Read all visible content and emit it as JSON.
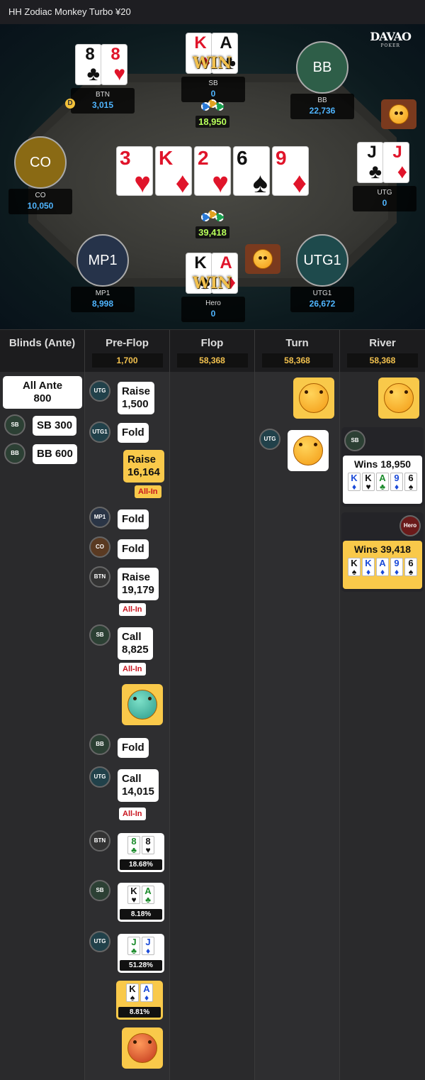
{
  "title": "HH  Zodiac Monkey Turbo ¥20",
  "logo": {
    "name": "DAVAO",
    "sub": "POKER"
  },
  "seats": [
    {
      "id": "btn",
      "name": "BTN",
      "stack": "3,015"
    },
    {
      "id": "sb",
      "name": "SB",
      "stack": "0",
      "win": "WIN"
    },
    {
      "id": "bb",
      "name": "BB",
      "avatar": "BB",
      "stack": "22,736"
    },
    {
      "id": "co",
      "name": "CO",
      "avatar": "CO",
      "stack": "10,050"
    },
    {
      "id": "utg",
      "name": "UTG",
      "stack": "0"
    },
    {
      "id": "mp1",
      "name": "MP1",
      "avatar": "MP1",
      "stack": "8,998"
    },
    {
      "id": "hero",
      "name": "Hero",
      "stack": "0",
      "win": "WIN"
    },
    {
      "id": "utg1",
      "name": "UTG1",
      "avatar": "UTG1",
      "stack": "26,672"
    }
  ],
  "pots": {
    "side": "18,950",
    "main": "39,418"
  },
  "board": [
    {
      "r": "3",
      "s": "♥"
    },
    {
      "r": "K",
      "s": "♦"
    },
    {
      "r": "2",
      "s": "♥"
    },
    {
      "r": "6",
      "s": "♠"
    },
    {
      "r": "9",
      "s": "♦"
    }
  ],
  "columns": [
    {
      "title": "Blinds (Ante)",
      "pot": ""
    },
    {
      "title": "Pre-Flop",
      "pot": "1,700"
    },
    {
      "title": "Flop",
      "pot": "58,368"
    },
    {
      "title": "Turn",
      "pot": "58,368"
    },
    {
      "title": "River",
      "pot": "58,368"
    }
  ],
  "blinds": {
    "ante_label": "All Ante",
    "ante_value": "800",
    "sb": "SB  300",
    "bb": "BB  600"
  },
  "preflop": {
    "utg_raise": "Raise",
    "utg_raise_amt": "1,500",
    "utg1_fold": "Fold",
    "hero_raise": "Raise",
    "hero_raise_amt": "16,164",
    "allin": "All-In",
    "mp1_fold": "Fold",
    "co_fold": "Fold",
    "btn_raise": "Raise",
    "btn_raise_amt": "19,179",
    "sb_call": "Call",
    "sb_call_amt": "8,825",
    "bb_fold": "Fold",
    "utg_call": "Call",
    "utg_call_amt": "14,015",
    "eq_btn": "18.68%",
    "eq_sb": "8.18%",
    "eq_utg": "51.28%",
    "eq_hero": "8.81%"
  },
  "positions": {
    "utg": "UTG",
    "utg1": "UTG1",
    "mp1": "MP1",
    "co": "CO",
    "btn": "BTN",
    "sb": "SB",
    "bb": "BB",
    "hero": "Hero"
  },
  "river": {
    "sb_wins": "Wins 18,950",
    "hero_wins": "Wins 39,418"
  }
}
